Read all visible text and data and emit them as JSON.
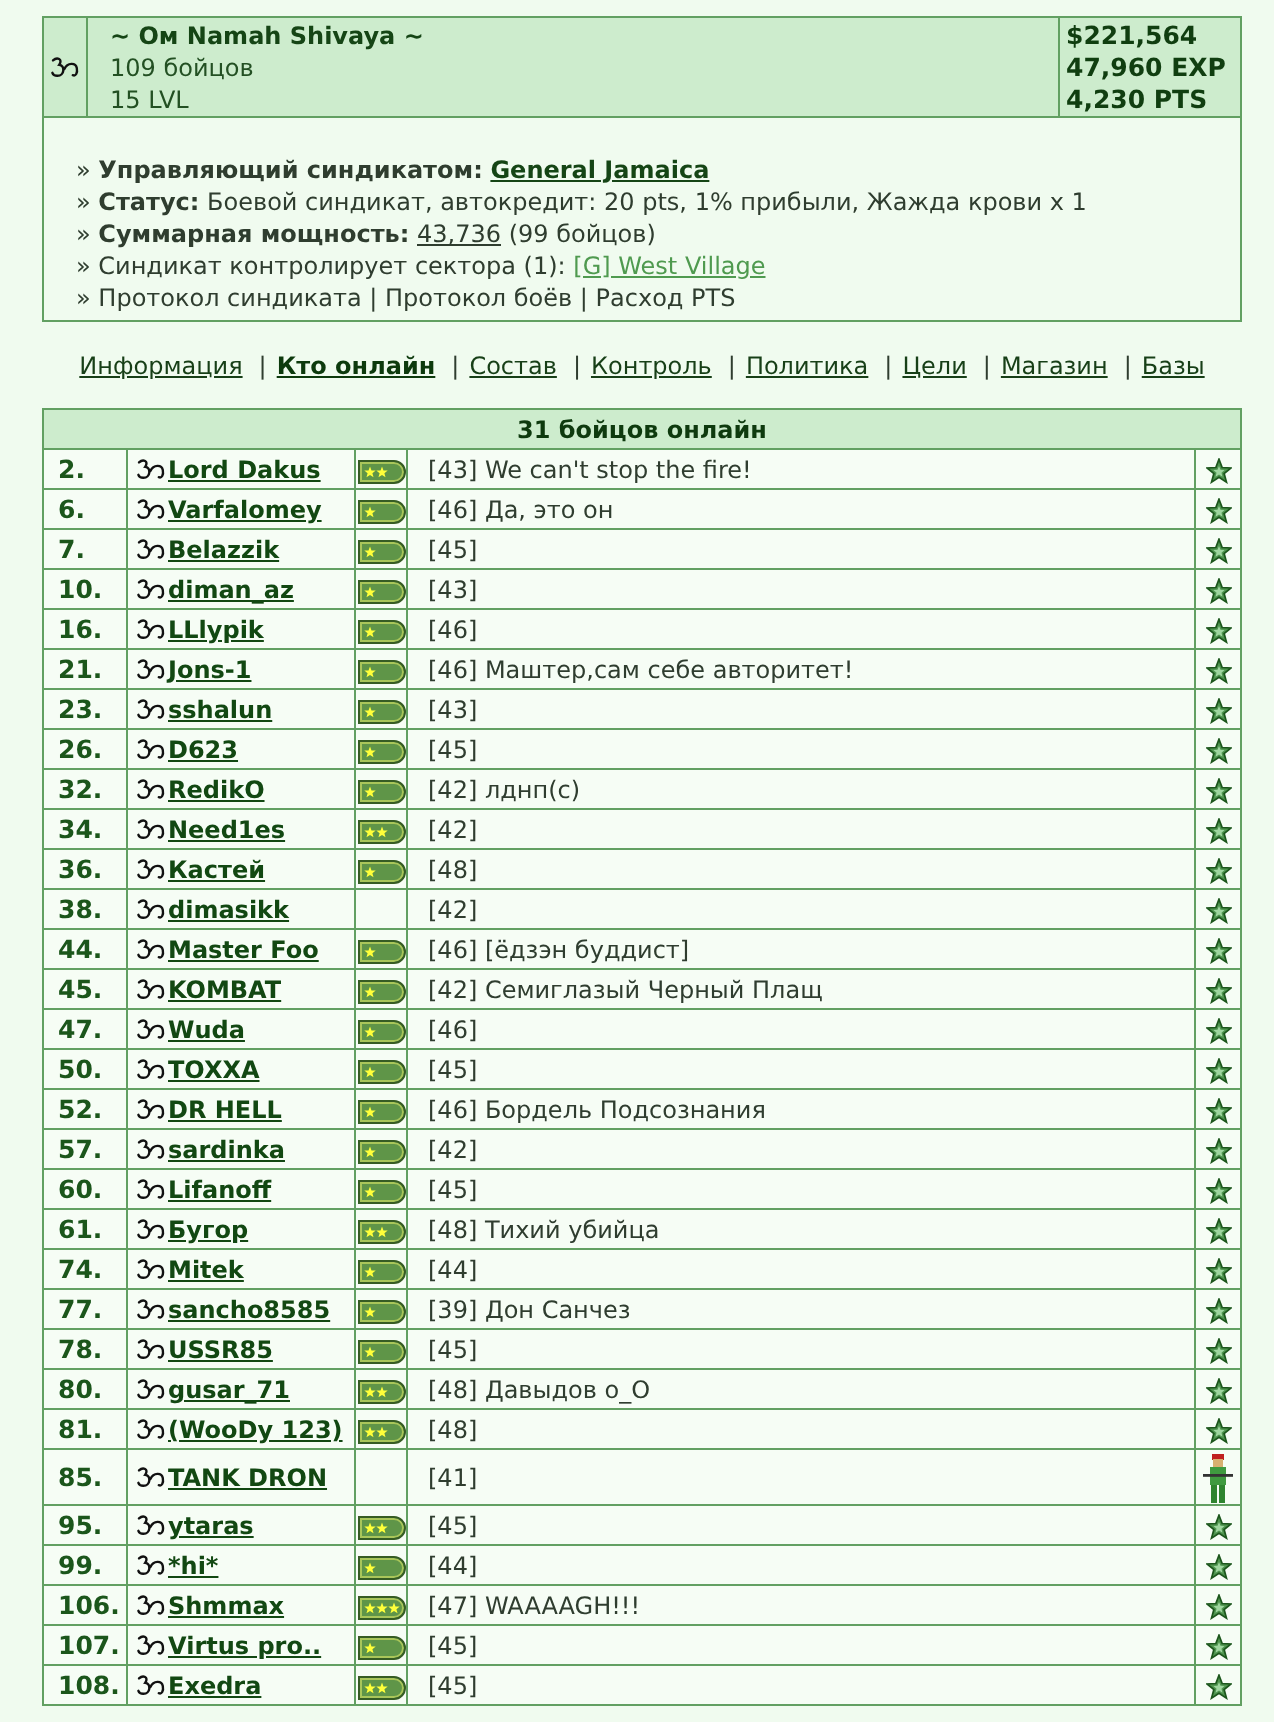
{
  "clan": {
    "name": "~ Ом Namah Shivaya ~",
    "fighters": "109 бойцов",
    "level": "15 LVL",
    "stats": [
      "$221,564",
      "47,960 EXP",
      "4,230 PTS"
    ]
  },
  "info": [
    {
      "text": "» **Управляющий синдикатом:**",
      "links": [
        {
          "label": "General Jamaica",
          "kind": "player"
        }
      ]
    },
    {
      "text": "» **Статус:** Боевой синдикат, автокредит: 20 pts, 1% прибыли, Жажда крови x 1"
    },
    {
      "text": "» **Суммарная мощность:**",
      "links": [
        {
          "label": "43,736",
          "kind": "number"
        }
      ],
      "tail": "(99 бойцов)"
    },
    {
      "text": "» Синдикат контролирует сектора (1):",
      "links": [
        {
          "label": "[G] West Village",
          "kind": "sector"
        }
      ]
    },
    {
      "text": "»",
      "links": [
        {
          "label": "Протокол синдиката",
          "kind": "plain"
        },
        {
          "label": "Протокол боёв",
          "kind": "plain"
        },
        {
          "label": "Расход PTS",
          "kind": "plain"
        }
      ],
      "separator": "|"
    }
  ],
  "nav": {
    "separator": "|",
    "items": [
      {
        "label": "Информация",
        "selected": false
      },
      {
        "label": "Кто онлайн",
        "selected": true
      },
      {
        "label": "Состав",
        "selected": false
      },
      {
        "label": "Контроль",
        "selected": false
      },
      {
        "label": "Политика",
        "selected": false
      },
      {
        "label": "Цели",
        "selected": false
      },
      {
        "label": "Магазин",
        "selected": false
      },
      {
        "label": "Базы",
        "selected": false
      }
    ]
  },
  "online": {
    "title": "31 бойцов онлайн",
    "rows": [
      {
        "rank": "2.",
        "name": "Lord Dakus",
        "insignia": {
          "kind": "double"
        },
        "info": "[43] We can't stop the fire!",
        "kind": "star"
      },
      {
        "rank": "6.",
        "name": "Varfalomey",
        "insignia": {
          "kind": "single"
        },
        "info": "[46] Да, это он",
        "kind": "star"
      },
      {
        "rank": "7.",
        "name": "Belazzik",
        "insignia": {
          "kind": "single"
        },
        "info": "[45]",
        "kind": "star"
      },
      {
        "rank": "10.",
        "name": "diman_az",
        "insignia": {
          "kind": "single"
        },
        "info": "[43]",
        "kind": "star"
      },
      {
        "rank": "16.",
        "name": "LLlypik",
        "insignia": {
          "kind": "single"
        },
        "info": "[46]",
        "kind": "star"
      },
      {
        "rank": "21.",
        "name": "Jons-1",
        "insignia": {
          "kind": "single"
        },
        "info": "[46] Маштер,сам себе авторитет!",
        "kind": "star"
      },
      {
        "rank": "23.",
        "name": "sshalun",
        "insignia": {
          "kind": "single"
        },
        "info": "[43]",
        "kind": "star"
      },
      {
        "rank": "26.",
        "name": "D623",
        "insignia": {
          "kind": "single"
        },
        "info": "[45]",
        "kind": "star"
      },
      {
        "rank": "32.",
        "name": "RedikO",
        "insignia": {
          "kind": "single"
        },
        "info": "[42] лднп(с)",
        "kind": "star"
      },
      {
        "rank": "34.",
        "name": "Need1es",
        "insignia": {
          "kind": "double"
        },
        "info": "[42]",
        "kind": "star"
      },
      {
        "rank": "36.",
        "name": "Кастей",
        "insignia": {
          "kind": "single"
        },
        "info": "[48]",
        "kind": "star"
      },
      {
        "rank": "38.",
        "name": "dimasikk",
        "info": "[42]",
        "kind": "star"
      },
      {
        "rank": "44.",
        "name": "Master Foo",
        "insignia": {
          "kind": "single"
        },
        "info": "[46] [ёдзэн буддист]",
        "kind": "star"
      },
      {
        "rank": "45.",
        "name": "KOMBAT",
        "insignia": {
          "kind": "single"
        },
        "info": "[42] Семиглазый Черный Плащ",
        "kind": "star"
      },
      {
        "rank": "47.",
        "name": "Wuda",
        "insignia": {
          "kind": "single"
        },
        "info": "[46]",
        "kind": "star"
      },
      {
        "rank": "50.",
        "name": "TOXXA",
        "insignia": {
          "kind": "single"
        },
        "info": "[45]",
        "kind": "star"
      },
      {
        "rank": "52.",
        "name": "DR HELL",
        "insignia": {
          "kind": "single"
        },
        "info": "[46] Бордель Подсознания",
        "kind": "star"
      },
      {
        "rank": "57.",
        "name": "sardinka",
        "insignia": {
          "kind": "single"
        },
        "info": "[42]",
        "kind": "star"
      },
      {
        "rank": "60.",
        "name": "Lifanoff",
        "insignia": {
          "kind": "single"
        },
        "info": "[45]",
        "kind": "star"
      },
      {
        "rank": "61.",
        "name": "Бугор",
        "insignia": {
          "kind": "double"
        },
        "info": "[48] Тихий убийца",
        "kind": "star"
      },
      {
        "rank": "74.",
        "name": "Mitek",
        "insignia": {
          "kind": "single"
        },
        "info": "[44]",
        "kind": "star"
      },
      {
        "rank": "77.",
        "name": "sancho8585",
        "insignia": {
          "kind": "single"
        },
        "info": "[39] Дон Санчез",
        "kind": "star"
      },
      {
        "rank": "78.",
        "name": "USSR85",
        "insignia": {
          "kind": "single"
        },
        "info": "[45]",
        "kind": "star"
      },
      {
        "rank": "80.",
        "name": "gusar_71",
        "insignia": {
          "kind": "double"
        },
        "info": "[48] Давыдов о_О",
        "kind": "star"
      },
      {
        "rank": "81.",
        "name": "(WooDy 123)",
        "insignia": {
          "kind": "double"
        },
        "info": "[48]",
        "kind": "star"
      },
      {
        "rank": "85.",
        "name": "TANK DRON",
        "info": "[41]",
        "kind": "soldier"
      },
      {
        "rank": "95.",
        "name": "ytaras",
        "insignia": {
          "kind": "double"
        },
        "info": "[45]",
        "kind": "star"
      },
      {
        "rank": "99.",
        "name": "*hi*",
        "insignia": {
          "kind": "single"
        },
        "info": "[44]",
        "kind": "star"
      },
      {
        "rank": "106.",
        "name": "Shmmax",
        "insignia": {
          "kind": "triple"
        },
        "info": "[47] WAAAAGH!!!",
        "kind": "star"
      },
      {
        "rank": "107.",
        "name": "Virtus pro..",
        "insignia": {
          "kind": "single"
        },
        "info": "[45]",
        "kind": "star"
      },
      {
        "rank": "108.",
        "name": "Exedra",
        "insignia": {
          "kind": "double"
        },
        "info": "[45]",
        "kind": "star"
      }
    ]
  }
}
